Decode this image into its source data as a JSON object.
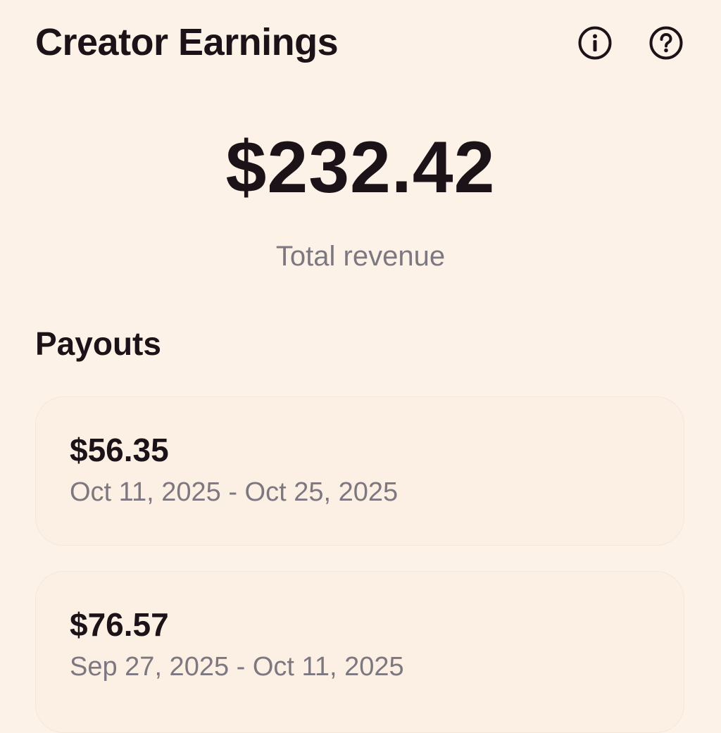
{
  "header": {
    "title": "Creator Earnings",
    "info_icon": "info-icon",
    "help_icon": "help-icon"
  },
  "summary": {
    "total_amount": "$232.42",
    "total_label": "Total revenue"
  },
  "payouts": {
    "title": "Payouts",
    "items": [
      {
        "amount": "$56.35",
        "range": "Oct 11, 2025 - Oct 25, 2025"
      },
      {
        "amount": "$76.57",
        "range": "Sep 27, 2025 - Oct 11, 2025"
      }
    ]
  },
  "colors": {
    "background": "#fdf2e7",
    "card": "#fcefe4",
    "text_primary": "#1c1319",
    "text_secondary": "#7d7880"
  }
}
